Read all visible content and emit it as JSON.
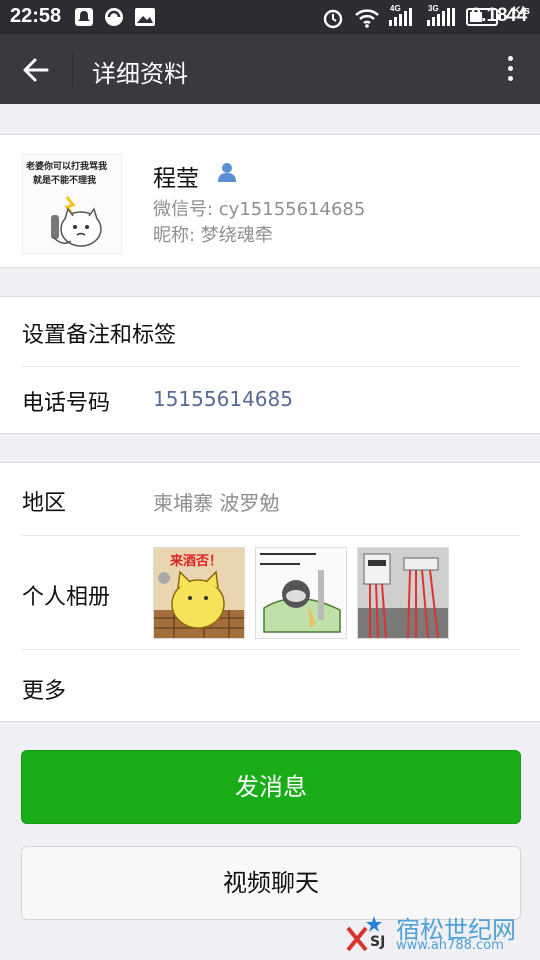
{
  "status_bar": {
    "time": "22:58",
    "speed": "0.18",
    "speed_unit": "K/s",
    "net1": "4G",
    "net2": "3G",
    "battery": "44",
    "icons": [
      "notification-icon",
      "sync-icon",
      "image-icon",
      "alarm-icon",
      "wifi-icon",
      "signal-icon",
      "signal-icon",
      "battery-icon"
    ]
  },
  "header": {
    "title": "详细资料"
  },
  "profile": {
    "name": "程莹",
    "wechat_id": "微信号: cy15155614685",
    "nickname": "昵称: 梦绕魂牵",
    "avatar_text_line1": "老婆你可以打我骂我",
    "avatar_text_line2": "就是不能不理我"
  },
  "rows": {
    "remark_label": "设置备注和标签",
    "phone_label": "电话号码",
    "phone_value": "15155614685",
    "region_label": "地区",
    "region_value": "柬埔寨  波罗勉",
    "album_label": "个人相册",
    "album_photo1_text": "来酒否！",
    "more_label": "更多"
  },
  "buttons": {
    "message": "发消息",
    "video_call": "视频聊天"
  },
  "watermark": {
    "site_cn": "宿松世纪网",
    "site_url": "www.ah788.com",
    "logo_text": "SJ"
  },
  "colors": {
    "title_bar": "#393a3f",
    "status_bar": "#2b2d32",
    "accent_green": "#1aad19",
    "phone_link": "#576b95",
    "secondary_text": "#8f8f8f"
  }
}
